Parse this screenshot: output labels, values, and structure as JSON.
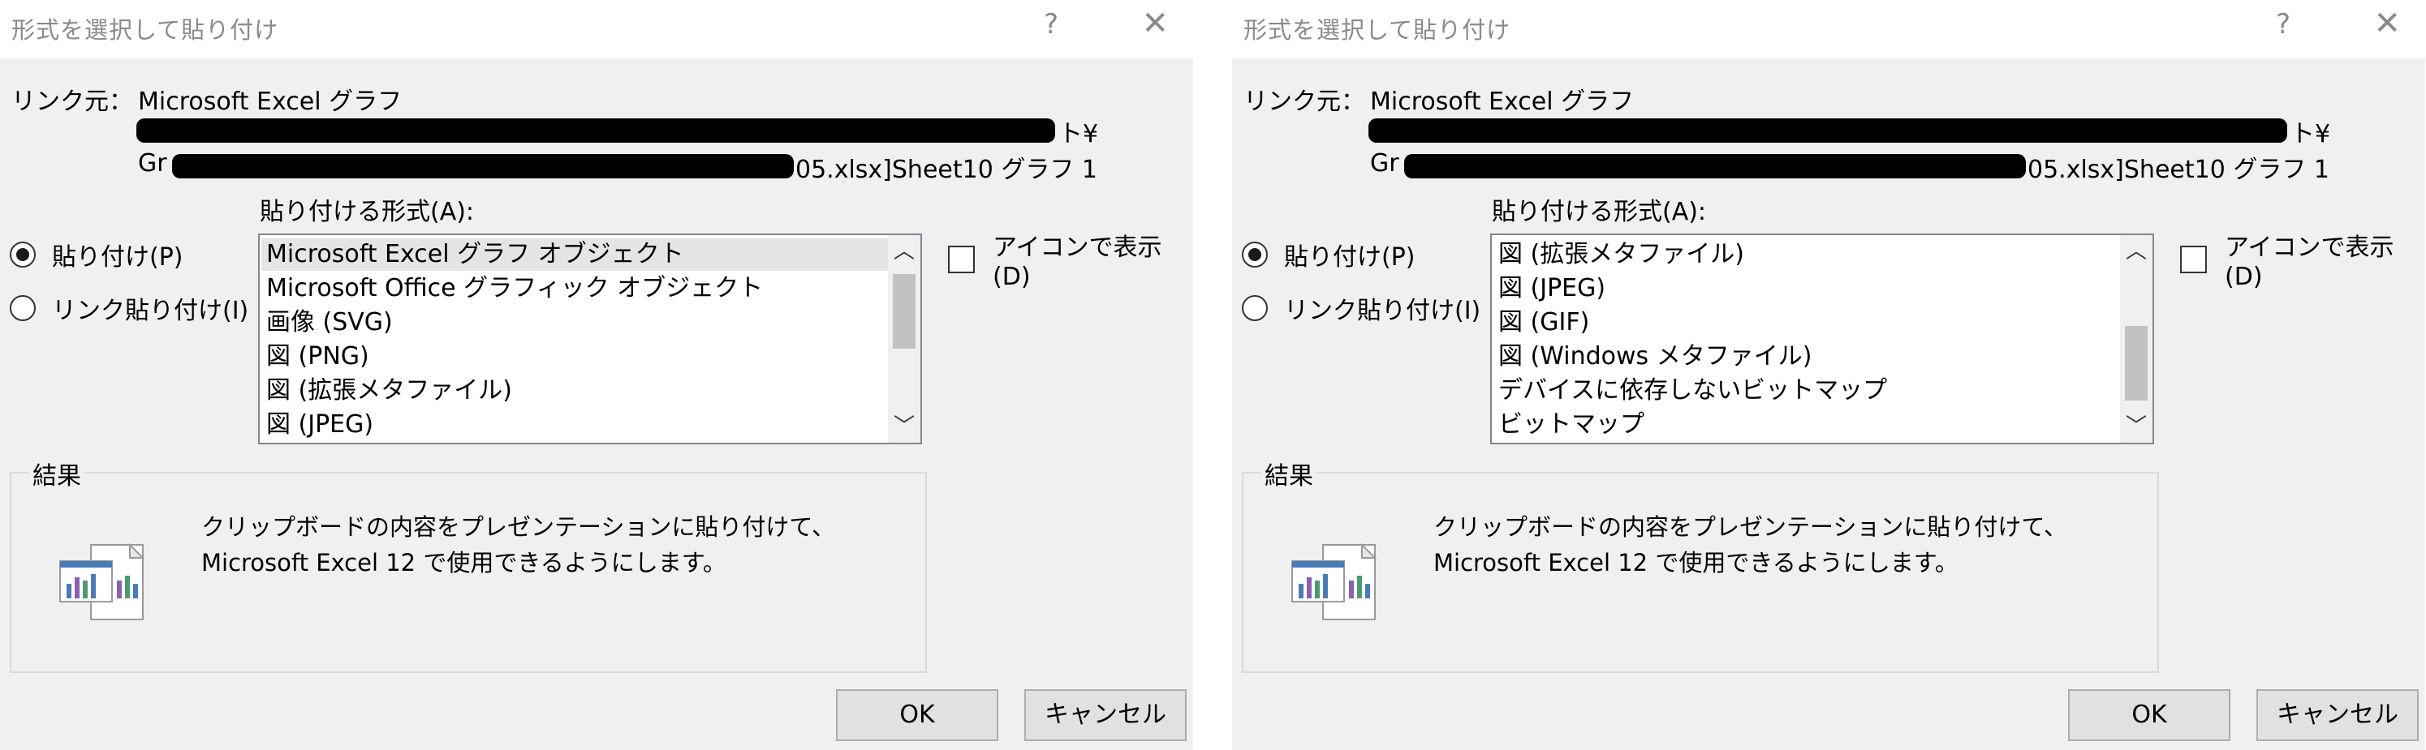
{
  "dialogs": [
    {
      "title": "形式を選択して貼り付け",
      "source_label": "リンク元：",
      "source_name": "Microsoft Excel グラフ",
      "path_line1_end": "ト¥",
      "path_line2_start": "Gr",
      "path_line2_end": "05.xlsx]Sheet10 グラフ 1",
      "format_label": "貼り付ける形式(A):",
      "radio_paste": "貼り付け(P)",
      "radio_link": "リンク貼り付け(I)",
      "show_as_icon": "アイコンで表示(D)",
      "formats": [
        "Microsoft Excel グラフ オブジェクト",
        "Microsoft Office グラフィック オブジェクト",
        "画像 (SVG)",
        "図 (PNG)",
        "図 (拡張メタファイル)",
        "図 (JPEG)"
      ],
      "selected_index": 0,
      "scroll_position": 0.1,
      "result_label": "結果",
      "result_text": "クリップボードの内容をプレゼンテーションに貼り付けて、Microsoft Excel 12 で使用できるようにします。",
      "ok": "OK",
      "cancel": "キャンセル"
    },
    {
      "title": "形式を選択して貼り付け",
      "source_label": "リンク元：",
      "source_name": "Microsoft Excel グラフ",
      "path_line1_end": "ト¥",
      "path_line2_start": "Gr",
      "path_line2_end": "05.xlsx]Sheet10 グラフ 1",
      "format_label": "貼り付ける形式(A):",
      "radio_paste": "貼り付け(P)",
      "radio_link": "リンク貼り付け(I)",
      "show_as_icon": "アイコンで表示(D)",
      "formats": [
        "図 (拡張メタファイル)",
        "図 (JPEG)",
        "図 (GIF)",
        "図 (Windows メタファイル)",
        "デバイスに依存しないビットマップ",
        "ビットマップ"
      ],
      "selected_index": -1,
      "scroll_position": 0.8,
      "result_label": "結果",
      "result_text": "クリップボードの内容をプレゼンテーションに貼り付けて、Microsoft Excel 12 で使用できるようにします。",
      "ok": "OK",
      "cancel": "キャンセル"
    }
  ]
}
